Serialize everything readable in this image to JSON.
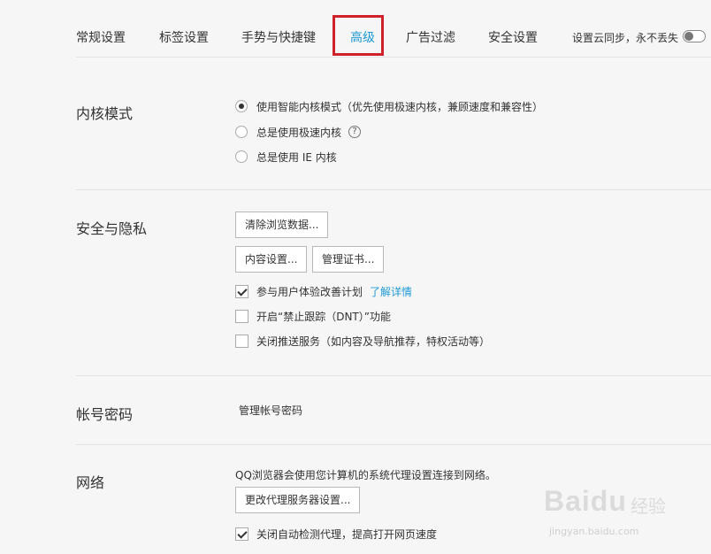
{
  "tabs": [
    {
      "label": "常规设置"
    },
    {
      "label": "标签设置"
    },
    {
      "label": "手势与快捷键"
    },
    {
      "label": "高级",
      "active": true
    },
    {
      "label": "广告过滤"
    },
    {
      "label": "安全设置"
    }
  ],
  "sync": {
    "label": "设置云同步，永不丢失",
    "enabled": false
  },
  "kernel": {
    "title": "内核模式",
    "options": [
      {
        "label": "使用智能内核模式（优先使用极速内核，兼顾速度和兼容性）",
        "selected": true
      },
      {
        "label": "总是使用极速内核",
        "selected": false
      },
      {
        "label": "总是使用 IE 内核",
        "selected": false
      }
    ],
    "help_icon": "?"
  },
  "privacy": {
    "title": "安全与隐私",
    "clear_button": "清除浏览数据...",
    "content_button": "内容设置...",
    "cert_button": "管理证书...",
    "checks": [
      {
        "label": "参与用户体验改善计划",
        "checked": true,
        "link": "了解详情"
      },
      {
        "label": "开启“禁止跟踪（DNT）”功能",
        "checked": false
      },
      {
        "label": "关闭推送服务（如内容及导航推荐，特权活动等）",
        "checked": false
      }
    ]
  },
  "account": {
    "title": "帐号密码",
    "link": "管理帐号密码"
  },
  "network": {
    "title": "网络",
    "description": "QQ浏览器会使用您计算机的系统代理设置连接到网络。",
    "proxy_button": "更改代理服务器设置...",
    "check": {
      "label": "关闭自动检测代理，提高打开网页速度",
      "checked": true
    }
  },
  "watermark": {
    "logo": "Baidu",
    "logo_cn": "经验",
    "url": "jingyan.baidu.com"
  },
  "colors": {
    "accent": "#1f9ad6",
    "highlight_border": "#d0202a",
    "background": "#f6f6f6"
  }
}
